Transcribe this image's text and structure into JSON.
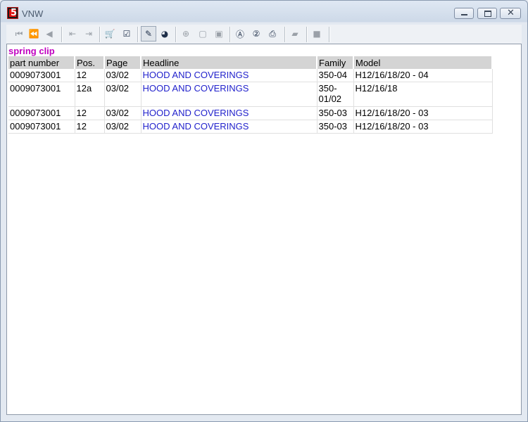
{
  "window": {
    "title": "VNW"
  },
  "toolbar": {
    "icons": [
      "first-icon",
      "prev-page-icon",
      "prev-icon",
      "export-icon",
      "import-icon",
      "cart-icon",
      "checklist-icon",
      "marker-icon",
      "globe-icon",
      "zoom-icon",
      "page-icon",
      "page-alt-icon",
      "search-a-icon",
      "search-2-icon",
      "print-icon",
      "notes-icon",
      "stop-icon"
    ]
  },
  "search_term": "spring clip",
  "table": {
    "headers": [
      "part number",
      "Pos.",
      "Page",
      "Headline",
      "Family",
      "Model"
    ],
    "rows": [
      [
        "0009073001",
        "12",
        "03/02",
        "HOOD AND COVERINGS",
        "350-04",
        "H12/16/18/20 - 04"
      ],
      [
        "0009073001",
        "12a",
        "03/02",
        "HOOD AND COVERINGS",
        "350-01/02",
        "H12/16/18"
      ],
      [
        "0009073001",
        "12",
        "03/02",
        "HOOD AND COVERINGS",
        "350-03",
        "H12/16/18/20 - 03"
      ],
      [
        "0009073001",
        "12",
        "03/02",
        "HOOD AND COVERINGS",
        "350-03",
        "H12/16/18/20 - 03"
      ]
    ]
  }
}
